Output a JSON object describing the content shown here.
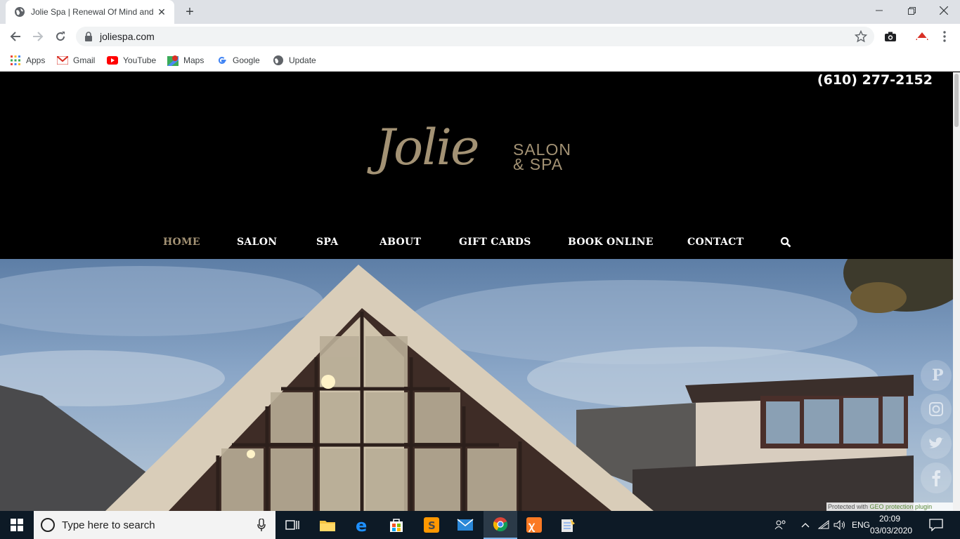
{
  "browser": {
    "tab_title": "Jolie Spa | Renewal Of Mind and",
    "url": "joliespa.com",
    "bookmarks": [
      "Apps",
      "Gmail",
      "YouTube",
      "Maps",
      "Google",
      "Update"
    ]
  },
  "site": {
    "phone": "(610) 277-2152",
    "logo_word": "Jolie",
    "logo_line1": "SALON",
    "logo_line2": "& SPA",
    "nav": [
      "HOME",
      "SALON",
      "SPA",
      "ABOUT",
      "GIFT CARDS",
      "BOOK ONLINE",
      "CONTACT"
    ],
    "active_nav": "HOME",
    "accent_color": "#a39274",
    "social_icons": [
      "pinterest-icon",
      "instagram-icon",
      "twitter-icon",
      "facebook-icon"
    ],
    "protection_prefix": "Protected with ",
    "protection_link": "GEO protection plugin"
  },
  "taskbar": {
    "search_placeholder": "Type here to search",
    "language": "ENG",
    "time": "20:09",
    "date": "03/03/2020"
  }
}
